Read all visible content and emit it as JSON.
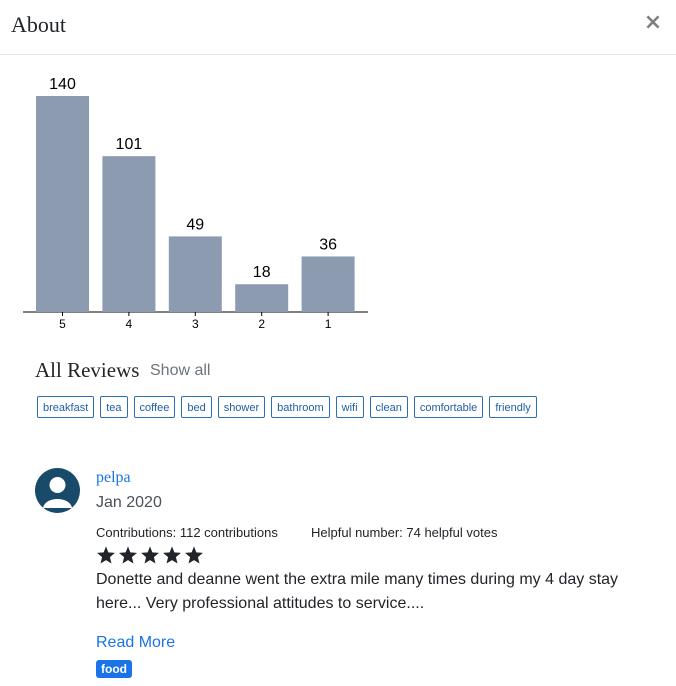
{
  "modal": {
    "title": "About",
    "close_label": "×"
  },
  "chart_data": {
    "type": "bar",
    "categories": [
      "5",
      "4",
      "3",
      "2",
      "1"
    ],
    "values": [
      140,
      101,
      49,
      18,
      36
    ],
    "title": "",
    "xlabel": "",
    "ylabel": "",
    "ylim": [
      0,
      140
    ],
    "bar_color": "#8c9bb0",
    "grid": false,
    "legend": "none"
  },
  "reviews": {
    "heading": "All Reviews",
    "show_all_label": "Show all",
    "tags": [
      "breakfast",
      "tea",
      "coffee",
      "bed",
      "shower",
      "bathroom",
      "wifi",
      "clean",
      "comfortable",
      "friendly"
    ],
    "items": [
      {
        "author": "pelpa",
        "avatar_icon": "user-avatar-icon",
        "date": "Jan 2020",
        "contributions": "Contributions: 112 contributions",
        "helpful": "Helpful number: 74 helpful votes",
        "rating": 5,
        "rating_max": 5,
        "text": "Donette and deanne went the extra mile many times during my 4 day stay here... Very professional attitudes to service....",
        "read_more_label": "Read More",
        "badge": "food"
      }
    ]
  },
  "colors": {
    "accent": "#1a73e8",
    "tag_border": "#2c6fb5",
    "bar": "#8c9bb0",
    "avatar_bg": "#1a4a6a"
  }
}
